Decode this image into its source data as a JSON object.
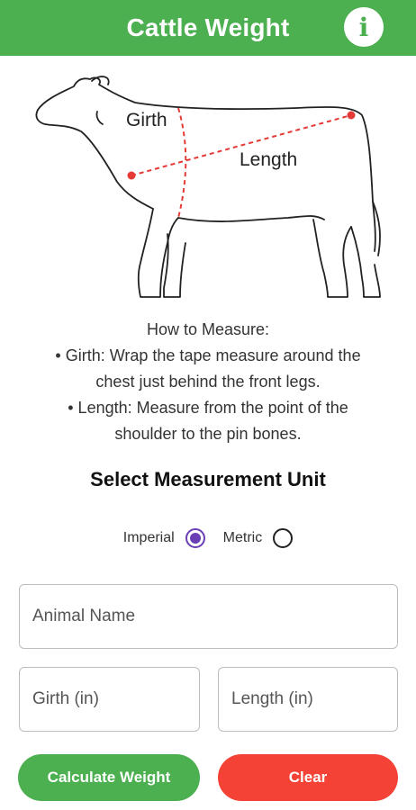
{
  "app_bar": {
    "title": "Cattle Weight",
    "info_icon": "info-icon"
  },
  "illustration": {
    "girth_label": "Girth",
    "length_label": "Length",
    "marker_color": "#e53935"
  },
  "instructions": {
    "heading": "How to Measure:",
    "lines": [
      "• Girth: Wrap the tape measure around the",
      "chest just behind the front legs.",
      "• Length: Measure from the point of the",
      "shoulder to the pin bones."
    ]
  },
  "unit_section": {
    "title": "Select Measurement Unit",
    "options": [
      {
        "label": "Imperial",
        "selected": true
      },
      {
        "label": "Metric",
        "selected": false
      }
    ]
  },
  "form": {
    "animal_name_placeholder": "Animal Name",
    "girth_placeholder": "Girth (in)",
    "length_placeholder": "Length (in)"
  },
  "buttons": {
    "calculate_label": "Calculate Weight",
    "clear_label": "Clear"
  },
  "colors": {
    "primary": "#4caf50",
    "danger": "#f44336",
    "radio_selected": "#6a3fb5"
  }
}
